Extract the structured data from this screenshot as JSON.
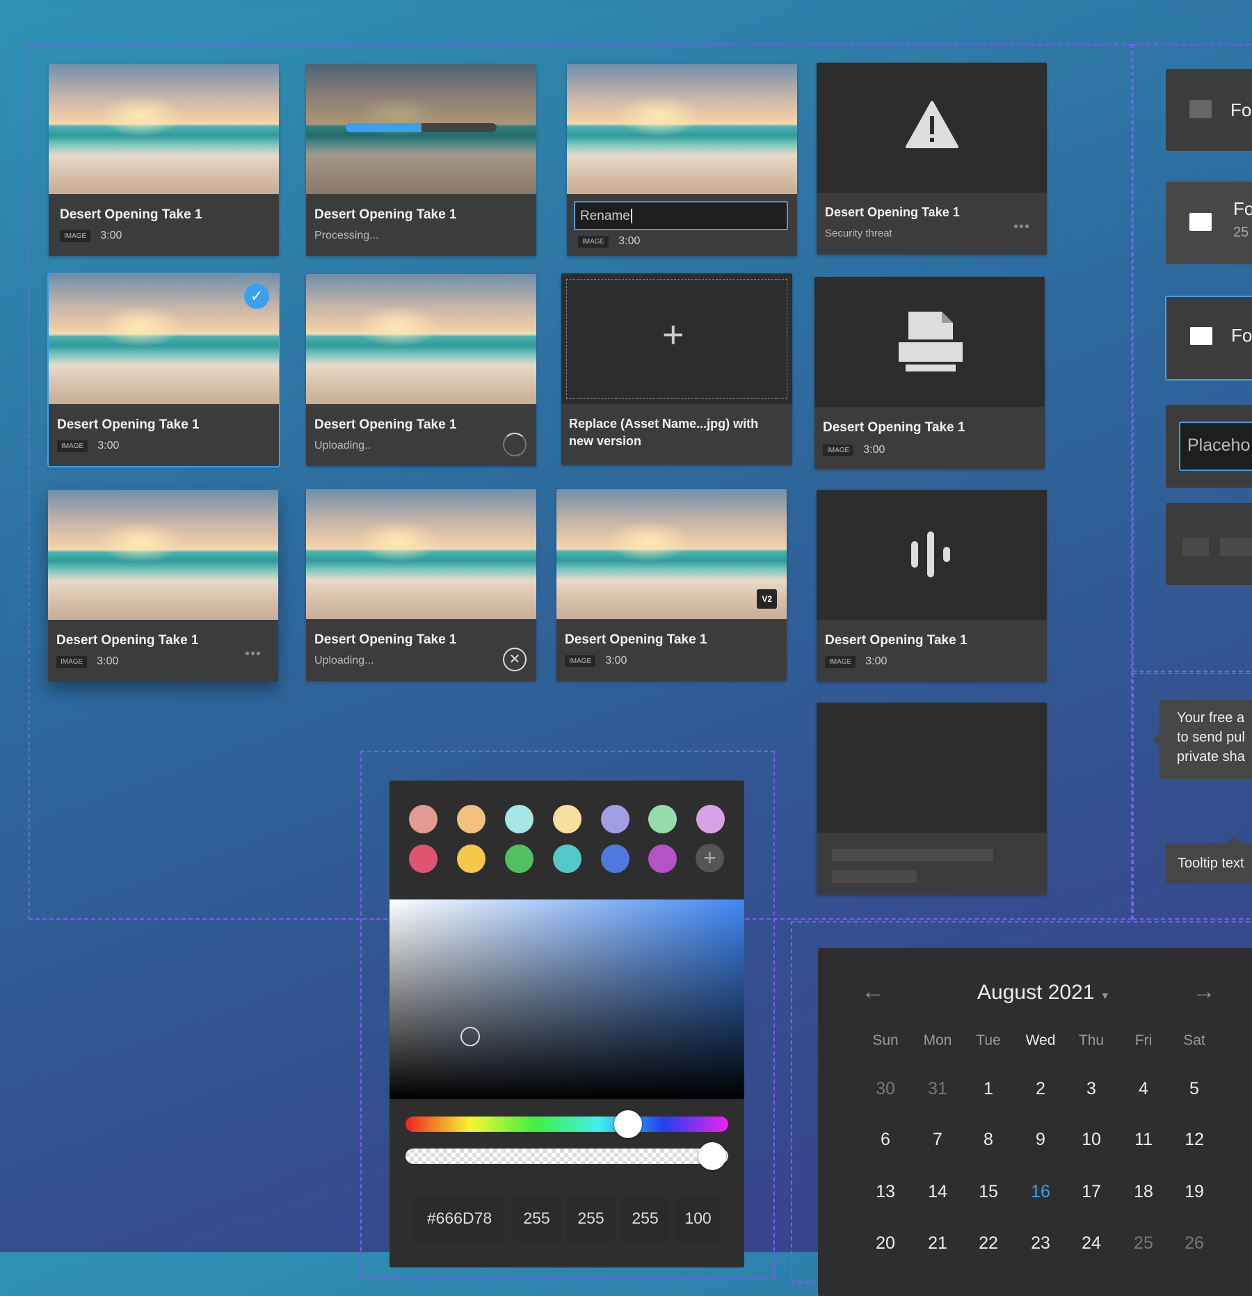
{
  "cards": [
    {
      "title": "Desert Opening Take 1",
      "tag": "IMAGE",
      "duration": "3:00"
    },
    {
      "title": "Desert Opening Take 1",
      "status": "Processing...",
      "progress": 0.5
    },
    {
      "rename_value": "Rename",
      "tag": "IMAGE",
      "duration": "3:00"
    },
    {
      "title": "Desert Opening Take 1",
      "status": "Security threat"
    },
    {
      "title": "Desert Opening Take 1",
      "tag": "IMAGE",
      "duration": "3:00"
    },
    {
      "title": "Desert Opening Take 1",
      "status": "Uploading.."
    },
    {
      "replace_text": "Replace (Asset Name...jpg) with new version"
    },
    {
      "title": "Desert Opening Take 1",
      "tag": "IMAGE",
      "duration": "3:00"
    },
    {
      "title": "Desert Opening Take 1",
      "tag": "IMAGE",
      "duration": "3:00"
    },
    {
      "title": "Desert Opening Take 1",
      "status": "Uploading..."
    },
    {
      "title": "Desert Opening Take 1",
      "tag": "IMAGE",
      "duration": "3:00",
      "version": "V2"
    },
    {
      "title": "Desert Opening Take 1",
      "tag": "IMAGE",
      "duration": "3:00"
    }
  ],
  "folders": [
    {
      "label": "Fo"
    },
    {
      "label": "Fo",
      "count": "25"
    },
    {
      "label": "Fo"
    }
  ],
  "folder_input_placeholder": "Placeho",
  "tooltips": {
    "long": [
      "Your free a",
      "to send pul",
      "private sha"
    ],
    "short": "Tooltip text"
  },
  "color_picker": {
    "swatches": [
      "#e39a94",
      "#f4c07e",
      "#a5e6e6",
      "#f7df9e",
      "#a29ee6",
      "#95dcab",
      "#d7a3e6",
      "#e05470",
      "#f5c84c",
      "#52c060",
      "#56c7c8",
      "#4f79e0",
      "#b452c6"
    ],
    "hex": "#666D78",
    "r": "255",
    "g": "255",
    "b": "255",
    "a": "100",
    "hue": 0.69,
    "alpha": 1.0
  },
  "calendar": {
    "month": "August 2021",
    "weekdays": [
      "Sun",
      "Mon",
      "Tue",
      "Wed",
      "Thu",
      "Fri",
      "Sat"
    ],
    "weeks": [
      [
        "30",
        "31",
        "1",
        "2",
        "3",
        "4",
        "5"
      ],
      [
        "6",
        "7",
        "8",
        "9",
        "10",
        "11",
        "12"
      ],
      [
        "13",
        "14",
        "15",
        "16",
        "17",
        "18",
        "19"
      ],
      [
        "20",
        "21",
        "22",
        "23",
        "24",
        "25",
        "26"
      ]
    ],
    "today": "16",
    "accent": "#3aa0f0"
  }
}
